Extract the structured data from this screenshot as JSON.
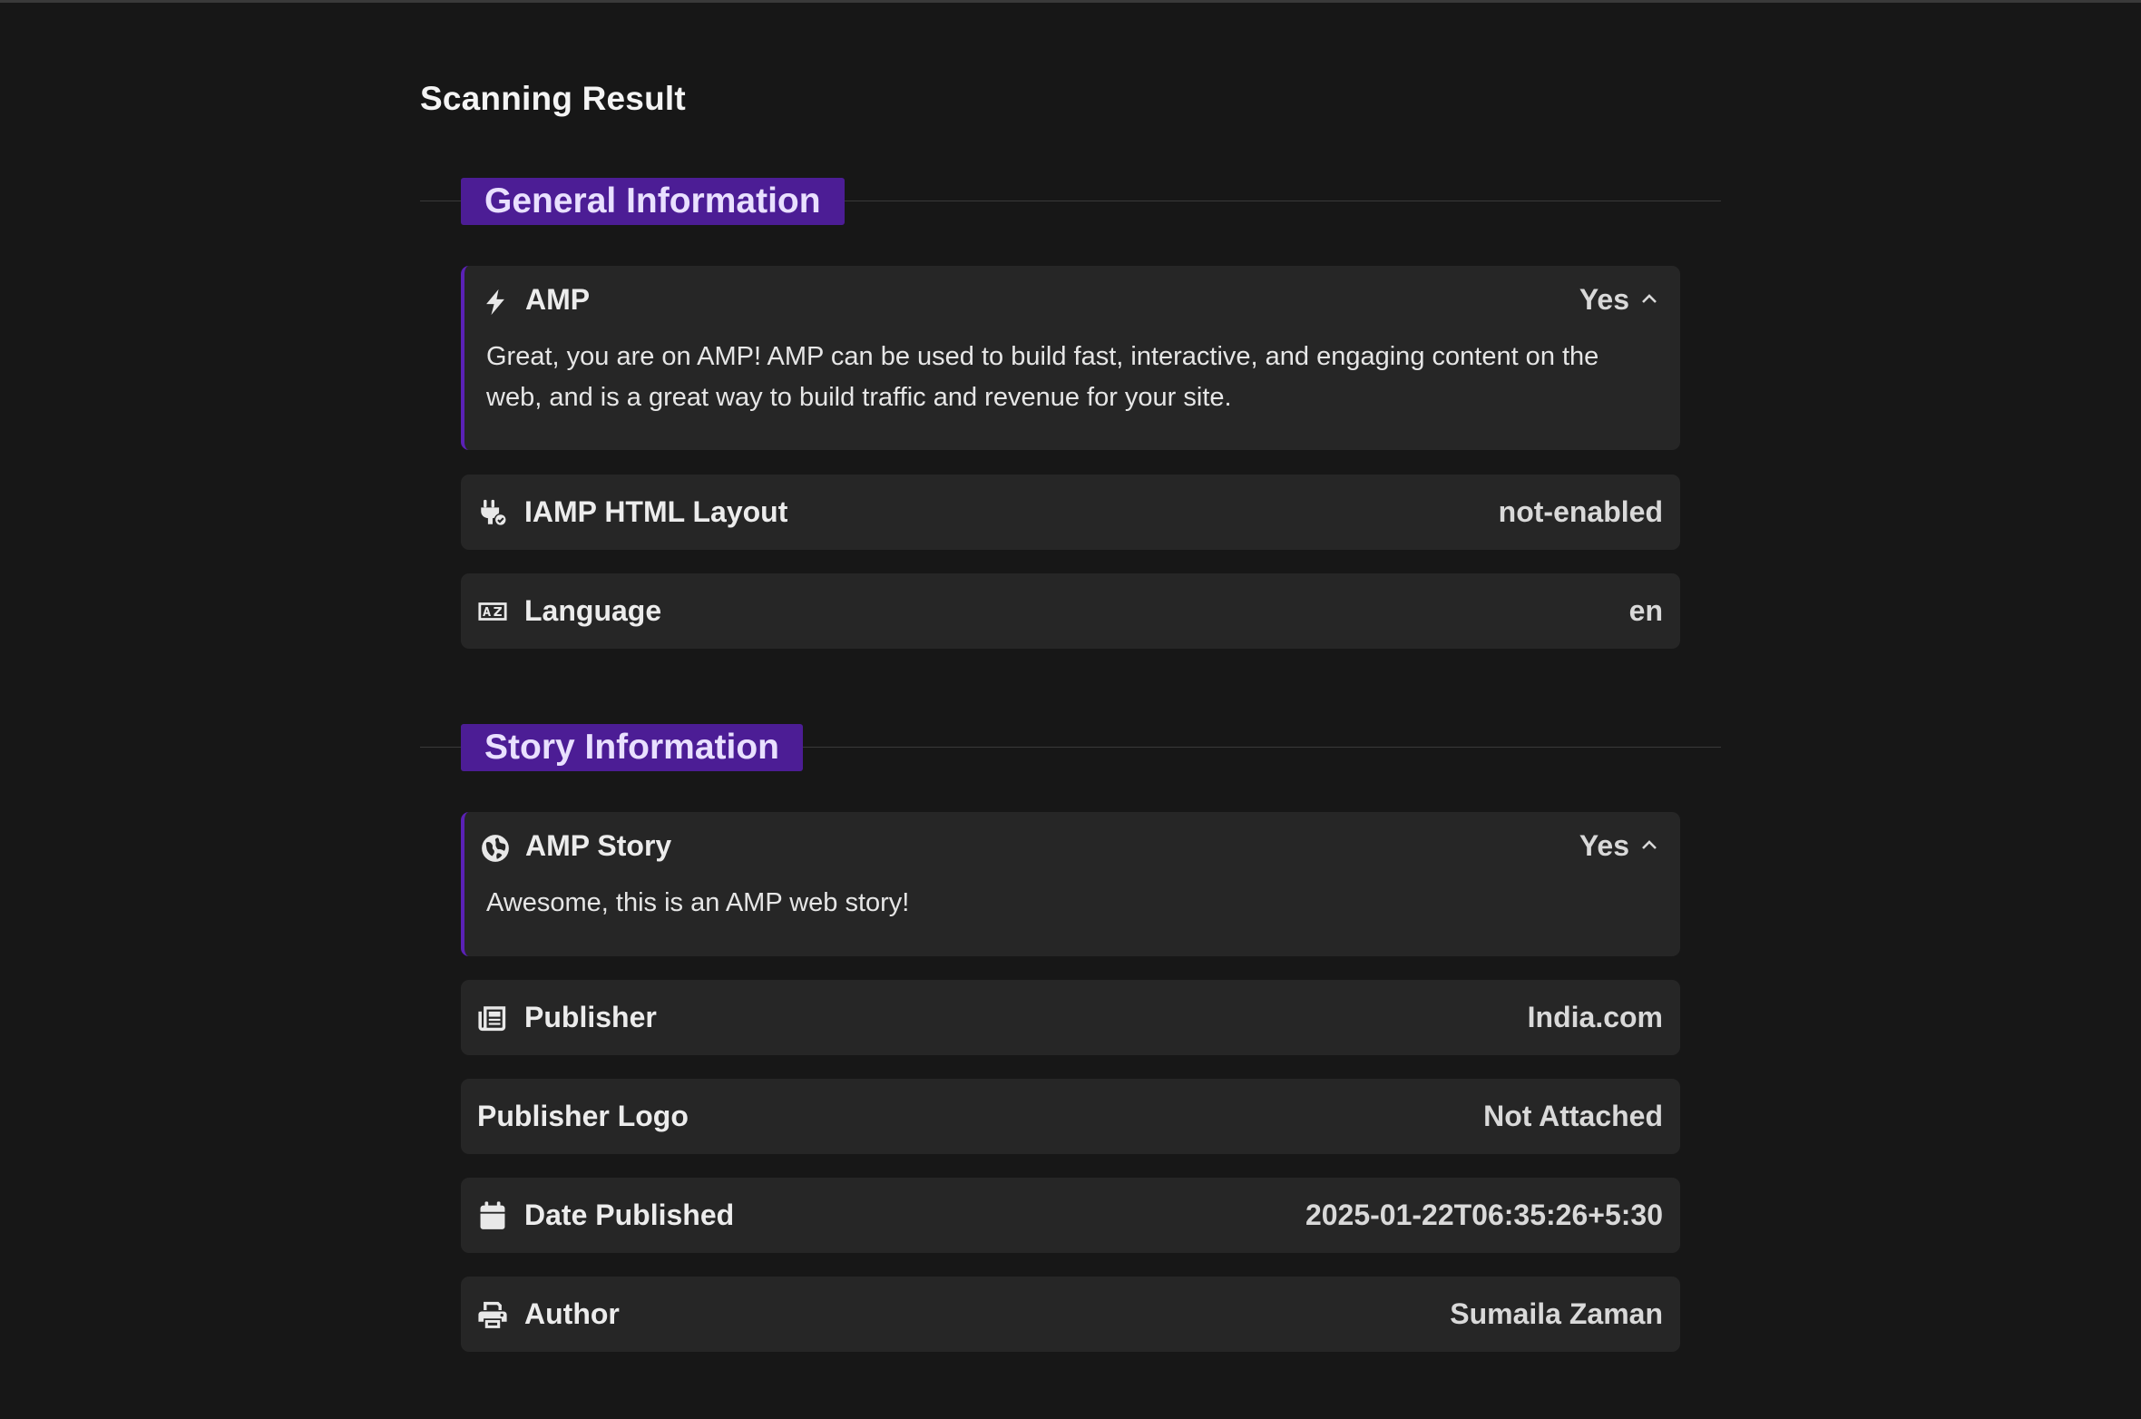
{
  "page": {
    "title": "Scanning Result"
  },
  "sections": [
    {
      "title": "General Information",
      "items": [
        {
          "icon": "bolt-icon",
          "label": "AMP",
          "value": "Yes",
          "expanded": true,
          "description": "Great, you are on AMP! AMP can be used to build fast, interactive, and engaging content on the web, and is a great way to build traffic and revenue for your site."
        },
        {
          "icon": "plug-check-icon",
          "label": "IAMP HTML Layout",
          "value": "not-enabled"
        },
        {
          "icon": "language-icon",
          "label": "Language",
          "value": "en"
        }
      ]
    },
    {
      "title": "Story Information",
      "items": [
        {
          "icon": "globe-icon",
          "label": "AMP Story",
          "value": "Yes",
          "expanded": true,
          "description": "Awesome, this is an AMP web story!"
        },
        {
          "icon": "newspaper-icon",
          "label": "Publisher",
          "value": "India.com"
        },
        {
          "icon": "",
          "label": "Publisher Logo",
          "value": "Not Attached"
        },
        {
          "icon": "calendar-icon",
          "label": "Date Published",
          "value": "2025-01-22T06:35:26+5:30"
        },
        {
          "icon": "printer-icon",
          "label": "Author",
          "value": "Sumaila Zaman"
        }
      ]
    }
  ],
  "colors": {
    "background": "#171717",
    "card": "#262626",
    "section_label_bg": "#4c1d95",
    "accent_border": "#5b21b6"
  }
}
